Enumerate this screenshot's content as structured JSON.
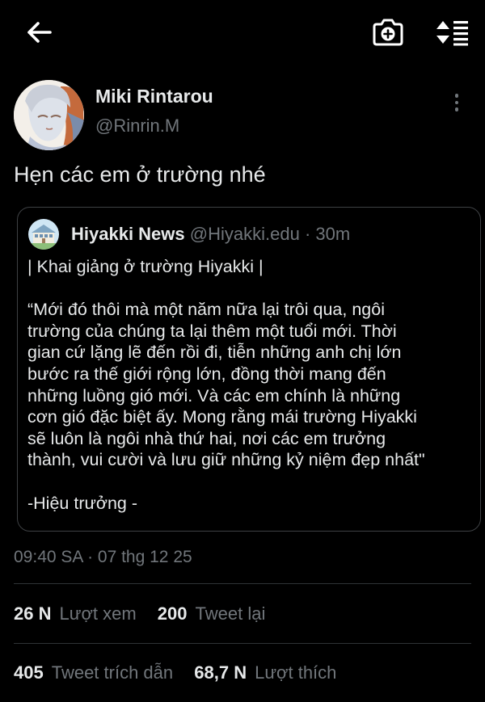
{
  "author": {
    "display_name": "Miki Rintarou",
    "handle": "@Rinrin.M"
  },
  "tweet": {
    "text": "Hẹn các em ở trường nhé"
  },
  "quoted_tweet": {
    "display_name": "Hiyakki News",
    "handle": "@Hiyakki.edu",
    "separator": "·",
    "time": "30m",
    "lines": [
      "| Khai giảng ở trường Hiyakki |",
      "",
      "“Mới đó thôi mà một năm nữa lại trôi qua, ngôi",
      "trường của chúng ta lại thêm một tuổi mới. Thời",
      "gian cứ lặng lẽ đến rồi đi, tiễn những anh chị lớn",
      "bước ra thế giới rộng lớn, đồng thời mang đến",
      "những luồng gió mới. Và các em chính là những",
      "cơn gió đặc biệt ấy. Mong rằng mái trường Hiyakki",
      "sẽ luôn là ngôi nhà thứ hai, nơi các em trưởng",
      "thành, vui cười và lưu giữ những kỷ niệm đẹp nhất\"",
      "",
      "-Hiệu trưởng -"
    ]
  },
  "meta": {
    "timestamp": "09:40 SA · 07 thg 12 25"
  },
  "stats": {
    "views_count": "26 N",
    "views_label": "Lượt xem",
    "retweets_count": "200",
    "retweets_label": "Tweet lại",
    "quotes_count": "405",
    "quotes_label": "Tweet trích dẫn",
    "likes_count": "68,7 N",
    "likes_label": "Lượt thích"
  },
  "icons": {
    "back": "arrow-left-icon",
    "camera": "camera-plus-icon",
    "sort": "sort-lines-icon",
    "more": "more-vertical-icon"
  },
  "colors": {
    "background": "#000000",
    "primary_text": "#e7e9ea",
    "secondary_text": "#71767b",
    "border": "#2f3336"
  }
}
